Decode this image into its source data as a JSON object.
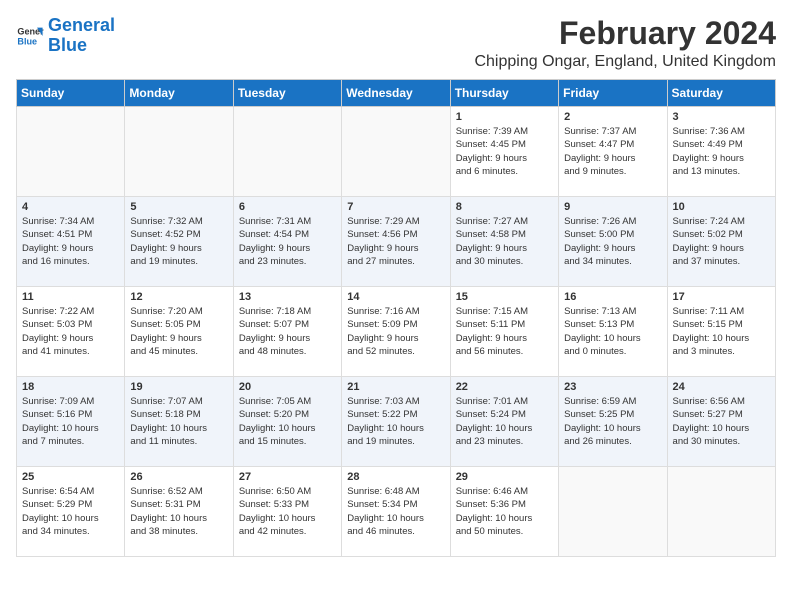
{
  "logo": {
    "line1": "General",
    "line2": "Blue"
  },
  "title": "February 2024",
  "subtitle": "Chipping Ongar, England, United Kingdom",
  "headers": [
    "Sunday",
    "Monday",
    "Tuesday",
    "Wednesday",
    "Thursday",
    "Friday",
    "Saturday"
  ],
  "weeks": [
    [
      {
        "day": "",
        "info": ""
      },
      {
        "day": "",
        "info": ""
      },
      {
        "day": "",
        "info": ""
      },
      {
        "day": "",
        "info": ""
      },
      {
        "day": "1",
        "info": "Sunrise: 7:39 AM\nSunset: 4:45 PM\nDaylight: 9 hours\nand 6 minutes."
      },
      {
        "day": "2",
        "info": "Sunrise: 7:37 AM\nSunset: 4:47 PM\nDaylight: 9 hours\nand 9 minutes."
      },
      {
        "day": "3",
        "info": "Sunrise: 7:36 AM\nSunset: 4:49 PM\nDaylight: 9 hours\nand 13 minutes."
      }
    ],
    [
      {
        "day": "4",
        "info": "Sunrise: 7:34 AM\nSunset: 4:51 PM\nDaylight: 9 hours\nand 16 minutes."
      },
      {
        "day": "5",
        "info": "Sunrise: 7:32 AM\nSunset: 4:52 PM\nDaylight: 9 hours\nand 19 minutes."
      },
      {
        "day": "6",
        "info": "Sunrise: 7:31 AM\nSunset: 4:54 PM\nDaylight: 9 hours\nand 23 minutes."
      },
      {
        "day": "7",
        "info": "Sunrise: 7:29 AM\nSunset: 4:56 PM\nDaylight: 9 hours\nand 27 minutes."
      },
      {
        "day": "8",
        "info": "Sunrise: 7:27 AM\nSunset: 4:58 PM\nDaylight: 9 hours\nand 30 minutes."
      },
      {
        "day": "9",
        "info": "Sunrise: 7:26 AM\nSunset: 5:00 PM\nDaylight: 9 hours\nand 34 minutes."
      },
      {
        "day": "10",
        "info": "Sunrise: 7:24 AM\nSunset: 5:02 PM\nDaylight: 9 hours\nand 37 minutes."
      }
    ],
    [
      {
        "day": "11",
        "info": "Sunrise: 7:22 AM\nSunset: 5:03 PM\nDaylight: 9 hours\nand 41 minutes."
      },
      {
        "day": "12",
        "info": "Sunrise: 7:20 AM\nSunset: 5:05 PM\nDaylight: 9 hours\nand 45 minutes."
      },
      {
        "day": "13",
        "info": "Sunrise: 7:18 AM\nSunset: 5:07 PM\nDaylight: 9 hours\nand 48 minutes."
      },
      {
        "day": "14",
        "info": "Sunrise: 7:16 AM\nSunset: 5:09 PM\nDaylight: 9 hours\nand 52 minutes."
      },
      {
        "day": "15",
        "info": "Sunrise: 7:15 AM\nSunset: 5:11 PM\nDaylight: 9 hours\nand 56 minutes."
      },
      {
        "day": "16",
        "info": "Sunrise: 7:13 AM\nSunset: 5:13 PM\nDaylight: 10 hours\nand 0 minutes."
      },
      {
        "day": "17",
        "info": "Sunrise: 7:11 AM\nSunset: 5:15 PM\nDaylight: 10 hours\nand 3 minutes."
      }
    ],
    [
      {
        "day": "18",
        "info": "Sunrise: 7:09 AM\nSunset: 5:16 PM\nDaylight: 10 hours\nand 7 minutes."
      },
      {
        "day": "19",
        "info": "Sunrise: 7:07 AM\nSunset: 5:18 PM\nDaylight: 10 hours\nand 11 minutes."
      },
      {
        "day": "20",
        "info": "Sunrise: 7:05 AM\nSunset: 5:20 PM\nDaylight: 10 hours\nand 15 minutes."
      },
      {
        "day": "21",
        "info": "Sunrise: 7:03 AM\nSunset: 5:22 PM\nDaylight: 10 hours\nand 19 minutes."
      },
      {
        "day": "22",
        "info": "Sunrise: 7:01 AM\nSunset: 5:24 PM\nDaylight: 10 hours\nand 23 minutes."
      },
      {
        "day": "23",
        "info": "Sunrise: 6:59 AM\nSunset: 5:25 PM\nDaylight: 10 hours\nand 26 minutes."
      },
      {
        "day": "24",
        "info": "Sunrise: 6:56 AM\nSunset: 5:27 PM\nDaylight: 10 hours\nand 30 minutes."
      }
    ],
    [
      {
        "day": "25",
        "info": "Sunrise: 6:54 AM\nSunset: 5:29 PM\nDaylight: 10 hours\nand 34 minutes."
      },
      {
        "day": "26",
        "info": "Sunrise: 6:52 AM\nSunset: 5:31 PM\nDaylight: 10 hours\nand 38 minutes."
      },
      {
        "day": "27",
        "info": "Sunrise: 6:50 AM\nSunset: 5:33 PM\nDaylight: 10 hours\nand 42 minutes."
      },
      {
        "day": "28",
        "info": "Sunrise: 6:48 AM\nSunset: 5:34 PM\nDaylight: 10 hours\nand 46 minutes."
      },
      {
        "day": "29",
        "info": "Sunrise: 6:46 AM\nSunset: 5:36 PM\nDaylight: 10 hours\nand 50 minutes."
      },
      {
        "day": "",
        "info": ""
      },
      {
        "day": "",
        "info": ""
      }
    ]
  ]
}
